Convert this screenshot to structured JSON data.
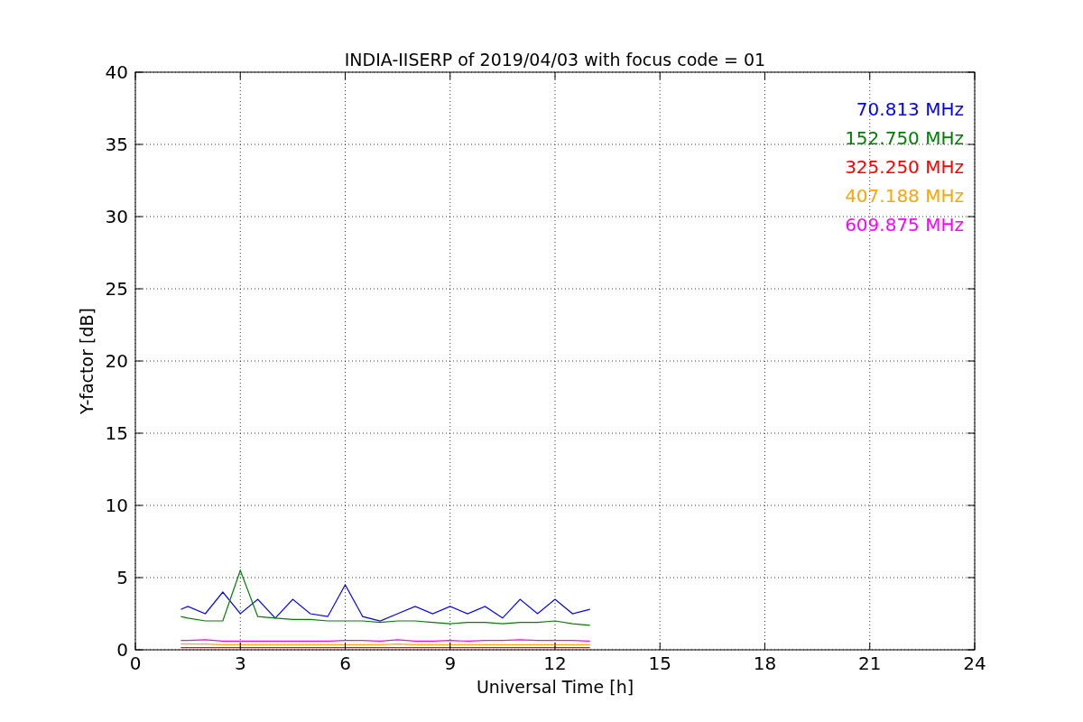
{
  "chart_data": {
    "type": "line",
    "title": "INDIA-IISERP of 2019/04/03 with focus code = 01",
    "xlabel": "Universal Time [h]",
    "ylabel": "Y-factor [dB]",
    "x": [
      1.3,
      1.5,
      2,
      2.5,
      3,
      3.5,
      4,
      4.5,
      5,
      5.5,
      6,
      6.5,
      7,
      7.5,
      8,
      8.5,
      9,
      9.5,
      10,
      10.5,
      11,
      11.5,
      12,
      12.5,
      13
    ],
    "series": [
      {
        "name": "70.813 MHz",
        "color": "#0000ff",
        "values": [
          2.8,
          3.0,
          2.5,
          4.0,
          2.5,
          3.5,
          2.2,
          3.5,
          2.5,
          2.3,
          4.5,
          2.3,
          2.0,
          2.5,
          3.0,
          2.5,
          3.0,
          2.5,
          3.0,
          2.2,
          3.5,
          2.5,
          3.5,
          2.5,
          2.8
        ]
      },
      {
        "name": "152.750 MHz",
        "color": "#008000",
        "values": [
          2.3,
          2.2,
          2.0,
          2.0,
          5.5,
          2.3,
          2.2,
          2.1,
          2.1,
          2.0,
          2.0,
          2.0,
          1.9,
          2.0,
          2.0,
          1.9,
          1.8,
          1.9,
          1.9,
          1.8,
          1.9,
          1.9,
          2.0,
          1.8,
          1.7
        ]
      },
      {
        "name": "325.250 MHz",
        "color": "#ff0000",
        "values": [
          0.15,
          0.15,
          0.15,
          0.15,
          0.15,
          0.15,
          0.15,
          0.15,
          0.15,
          0.15,
          0.15,
          0.15,
          0.15,
          0.15,
          0.15,
          0.15,
          0.15,
          0.15,
          0.15,
          0.15,
          0.15,
          0.15,
          0.15,
          0.15,
          0.15
        ]
      },
      {
        "name": "407.188 MHz",
        "color": "#ffa500",
        "values": [
          0.4,
          0.4,
          0.4,
          0.35,
          0.35,
          0.35,
          0.35,
          0.35,
          0.35,
          0.35,
          0.35,
          0.35,
          0.35,
          0.4,
          0.35,
          0.35,
          0.35,
          0.35,
          0.35,
          0.35,
          0.35,
          0.35,
          0.35,
          0.35,
          0.35
        ]
      },
      {
        "name": "609.875 MHz",
        "color": "#ff00ff",
        "values": [
          0.65,
          0.65,
          0.7,
          0.6,
          0.6,
          0.6,
          0.6,
          0.6,
          0.6,
          0.6,
          0.65,
          0.65,
          0.6,
          0.7,
          0.6,
          0.6,
          0.65,
          0.6,
          0.65,
          0.65,
          0.7,
          0.65,
          0.65,
          0.65,
          0.6
        ]
      }
    ],
    "grid": true,
    "xlim": [
      0,
      24
    ],
    "ylim": [
      0,
      40
    ],
    "xticks": [
      0,
      3,
      6,
      9,
      12,
      15,
      18,
      21,
      24
    ],
    "yticks": [
      0,
      5,
      10,
      15,
      20,
      25,
      30,
      35,
      40
    ]
  }
}
